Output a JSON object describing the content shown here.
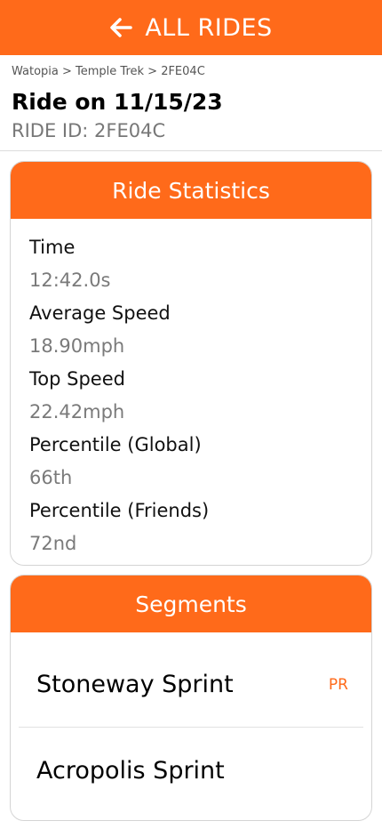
{
  "header": {
    "back_label": "ALL RIDES",
    "icon": "arrow-left-icon",
    "color": "#ff6a1a"
  },
  "breadcrumb": "Watopia > Temple Trek > 2FE04C",
  "ride": {
    "title": "Ride on 11/15/23",
    "id_label": "RIDE ID: 2FE04C"
  },
  "stats": {
    "title": "Ride Statistics",
    "items": [
      {
        "label": "Time",
        "value": "12:42.0s"
      },
      {
        "label": "Average Speed",
        "value": "18.90mph"
      },
      {
        "label": "Top Speed",
        "value": "22.42mph"
      },
      {
        "label": "Percentile (Global)",
        "value": "66th"
      },
      {
        "label": "Percentile (Friends)",
        "value": "72nd"
      }
    ]
  },
  "segments": {
    "title": "Segments",
    "items": [
      {
        "name": "Stoneway Sprint",
        "badge": "PR"
      },
      {
        "name": "Acropolis Sprint",
        "badge": ""
      }
    ]
  }
}
